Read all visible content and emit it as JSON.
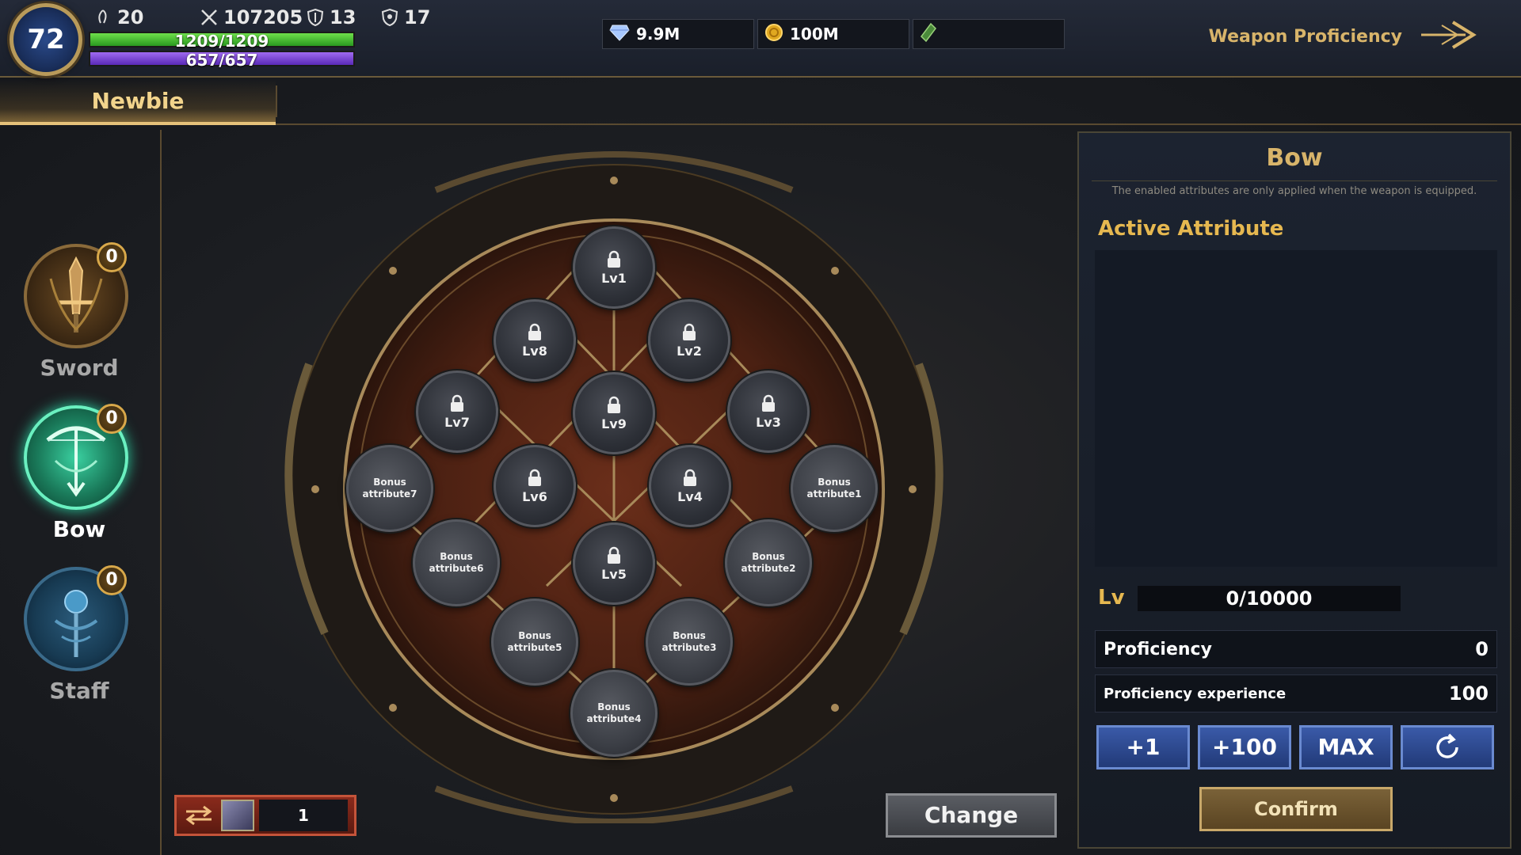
{
  "player": {
    "level": "72",
    "stat_a": "20",
    "power": "107205",
    "stat_c": "13",
    "stat_d": "17",
    "hp_text": "1209/1209",
    "hp_fraction": 1.0,
    "mp_text": "657/657",
    "mp_fraction": 1.0
  },
  "currency": {
    "diamonds": "9.9M",
    "gold": "100M",
    "third": ""
  },
  "header": {
    "title": "Weapon Proficiency"
  },
  "tabs": [
    {
      "label": "Newbie",
      "active": true
    }
  ],
  "weapons": [
    {
      "name": "Sword",
      "badge": "0",
      "active": false,
      "icon": "sword-icon"
    },
    {
      "name": "Bow",
      "badge": "0",
      "active": true,
      "icon": "bow-icon"
    },
    {
      "name": "Staff",
      "badge": "0",
      "active": false,
      "icon": "staff-icon"
    }
  ],
  "tree": {
    "levels": [
      "Lv1",
      "Lv2",
      "Lv3",
      "Lv4",
      "Lv5",
      "Lv6",
      "Lv7",
      "Lv8",
      "Lv9"
    ],
    "bonus": [
      [
        "Bonus",
        "attribute1"
      ],
      [
        "Bonus",
        "attribute2"
      ],
      [
        "Bonus",
        "attribute3"
      ],
      [
        "Bonus",
        "attribute4"
      ],
      [
        "Bonus",
        "attribute5"
      ],
      [
        "Bonus",
        "attribute6"
      ],
      [
        "Bonus",
        "attribute7"
      ]
    ]
  },
  "item": {
    "count": "1"
  },
  "buttons": {
    "change": "Change",
    "plus1": "+1",
    "plus100": "+100",
    "max": "MAX",
    "confirm": "Confirm"
  },
  "panel": {
    "title": "Bow",
    "note": "The enabled attributes are only applied when the weapon is equipped.",
    "active_attribute_title": "Active Attribute",
    "lv_label": "Lv",
    "lv_value": "0/10000",
    "proficiency_label": "Proficiency",
    "proficiency_value": "0",
    "exp_label": "Proficiency experience",
    "exp_value": "100"
  },
  "colors": {
    "gold_text": "#d8b46a",
    "hp_green": "#3fbf3a",
    "mp_purple": "#7a4ad8",
    "button_blue": "#3a5aa8"
  }
}
